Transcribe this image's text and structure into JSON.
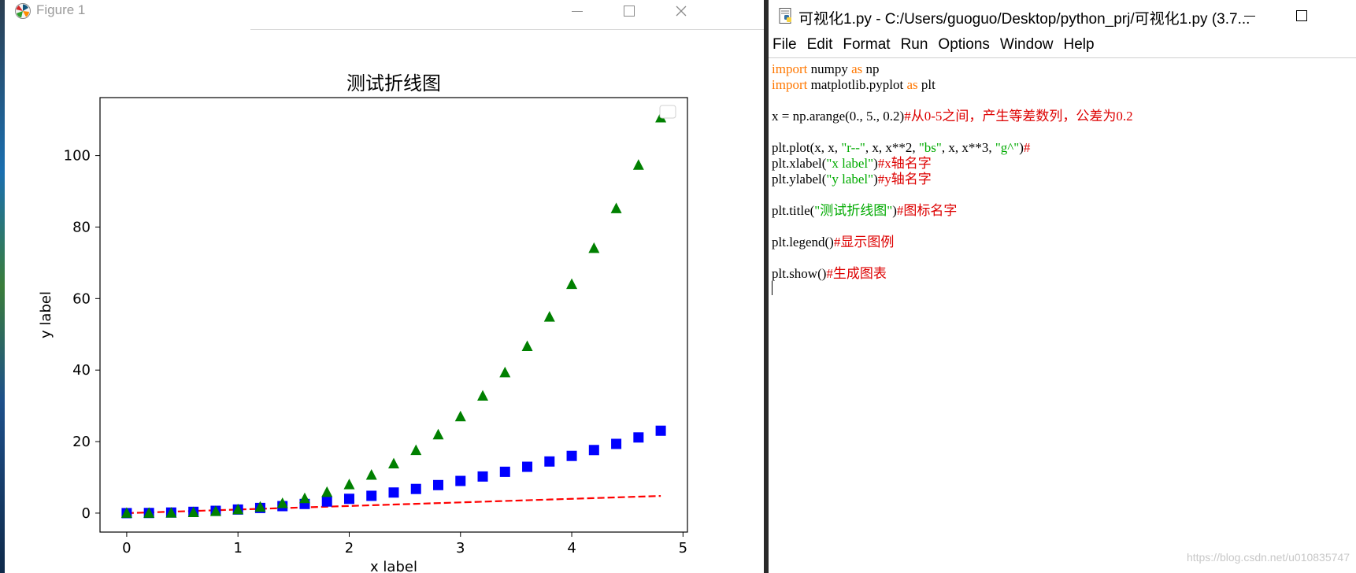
{
  "figure_window": {
    "title": "Figure 1",
    "controls": {
      "minimize": "—",
      "maximize": "☐",
      "close": "✕"
    }
  },
  "chart_data": {
    "type": "line",
    "title": "测试折线图",
    "xlabel": "x label",
    "ylabel": "y label",
    "xlim": [
      -0.24,
      5.04
    ],
    "ylim": [
      -5.3,
      116.2
    ],
    "xticks": [
      "0",
      "1",
      "2",
      "3",
      "4",
      "5"
    ],
    "xtick_values": [
      0,
      1,
      2,
      3,
      4,
      5
    ],
    "yticks": [
      "0",
      "20",
      "40",
      "60",
      "80",
      "100"
    ],
    "ytick_values": [
      0,
      20,
      40,
      60,
      80,
      100
    ],
    "x": [
      0,
      0.2,
      0.4,
      0.6,
      0.8,
      1.0,
      1.2,
      1.4,
      1.6,
      1.8,
      2.0,
      2.2,
      2.4,
      2.6,
      2.8,
      3.0,
      3.2,
      3.4,
      3.6,
      3.8,
      4.0,
      4.2,
      4.4,
      4.6,
      4.8
    ],
    "legend": "top-right (empty)",
    "series": [
      {
        "style": "dashed-line",
        "color": "#ff0000",
        "values": [
          0,
          0.2,
          0.4,
          0.6,
          0.8,
          1.0,
          1.2,
          1.4,
          1.6,
          1.8,
          2.0,
          2.2,
          2.4,
          2.6,
          2.8,
          3.0,
          3.2,
          3.4,
          3.6,
          3.8,
          4.0,
          4.2,
          4.4,
          4.6,
          4.8
        ]
      },
      {
        "style": "square-marker",
        "color": "#0000ff",
        "values": [
          0,
          0.04,
          0.16,
          0.36,
          0.64,
          1.0,
          1.44,
          1.96,
          2.56,
          3.24,
          4.0,
          4.84,
          5.76,
          6.76,
          7.84,
          9.0,
          10.24,
          11.56,
          12.96,
          14.44,
          16.0,
          17.64,
          19.36,
          21.16,
          23.04
        ]
      },
      {
        "style": "triangle-marker",
        "color": "#008000",
        "values": [
          0,
          0.008,
          0.064,
          0.216,
          0.512,
          1.0,
          1.728,
          2.744,
          4.096,
          5.832,
          8.0,
          10.648,
          13.824,
          17.576,
          21.952,
          27.0,
          32.768,
          39.304,
          46.656,
          54.872,
          64.0,
          74.088,
          85.184,
          97.336,
          110.592
        ]
      }
    ]
  },
  "editor_window": {
    "title": "可视化1.py - C:/Users/guoguo/Desktop/python_prj/可视化1.py (3.7...",
    "controls": {
      "minimize": "—",
      "maximize": "☐"
    },
    "menu": [
      "File",
      "Edit",
      "Format",
      "Run",
      "Options",
      "Window",
      "Help"
    ],
    "code": {
      "l1_kw1": "import",
      "l1_rest": " numpy ",
      "l1_kw2": "as",
      "l1_end": " np",
      "l2_kw1": "import",
      "l2_rest": " matplotlib.pyplot ",
      "l2_kw2": "as",
      "l2_end": " plt",
      "l3_code": "x = np.arange(0., 5., 0.2)",
      "l3_cm": "#从0-5之间，产生等差数列，公差为0.2",
      "l4_a": "plt.plot(x, x, ",
      "l4_s1": "\"r--\"",
      "l4_b": ", x, x**2, ",
      "l4_s2": "\"bs\"",
      "l4_c": ", x, x**3, ",
      "l4_s3": "\"g^\"",
      "l4_d": ")",
      "l4_cm": "#",
      "l5_a": "plt.xlabel(",
      "l5_s": "\"x label\"",
      "l5_b": ")",
      "l5_cm": "#x轴名字",
      "l6_a": "plt.ylabel(",
      "l6_s": "\"y label\"",
      "l6_b": ")",
      "l6_cm": "#y轴名字",
      "l7_a": "plt.title(",
      "l7_s": "\"测试折线图\"",
      "l7_b": ")",
      "l7_cm": "#图标名字",
      "l8_a": "plt.legend()",
      "l8_cm": "#显示图例",
      "l9_a": "plt.show()",
      "l9_cm": "#生成图表"
    }
  },
  "watermark": "https://blog.csdn.net/u010835747"
}
